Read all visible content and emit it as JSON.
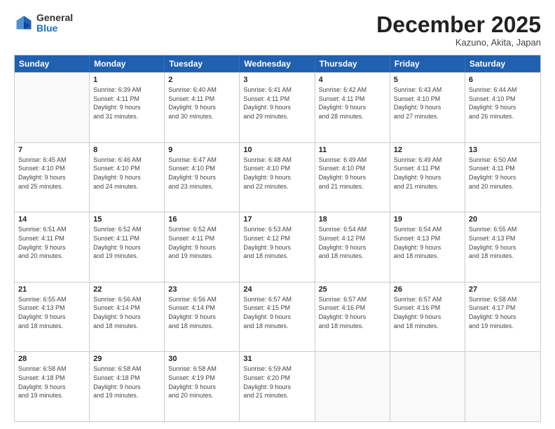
{
  "header": {
    "logo_general": "General",
    "logo_blue": "Blue",
    "month_title": "December 2025",
    "subtitle": "Kazuno, Akita, Japan"
  },
  "weekdays": [
    "Sunday",
    "Monday",
    "Tuesday",
    "Wednesday",
    "Thursday",
    "Friday",
    "Saturday"
  ],
  "rows": [
    [
      {
        "day": "",
        "info": ""
      },
      {
        "day": "1",
        "info": "Sunrise: 6:39 AM\nSunset: 4:11 PM\nDaylight: 9 hours\nand 31 minutes."
      },
      {
        "day": "2",
        "info": "Sunrise: 6:40 AM\nSunset: 4:11 PM\nDaylight: 9 hours\nand 30 minutes."
      },
      {
        "day": "3",
        "info": "Sunrise: 6:41 AM\nSunset: 4:11 PM\nDaylight: 9 hours\nand 29 minutes."
      },
      {
        "day": "4",
        "info": "Sunrise: 6:42 AM\nSunset: 4:11 PM\nDaylight: 9 hours\nand 28 minutes."
      },
      {
        "day": "5",
        "info": "Sunrise: 6:43 AM\nSunset: 4:10 PM\nDaylight: 9 hours\nand 27 minutes."
      },
      {
        "day": "6",
        "info": "Sunrise: 6:44 AM\nSunset: 4:10 PM\nDaylight: 9 hours\nand 26 minutes."
      }
    ],
    [
      {
        "day": "7",
        "info": "Sunrise: 6:45 AM\nSunset: 4:10 PM\nDaylight: 9 hours\nand 25 minutes."
      },
      {
        "day": "8",
        "info": "Sunrise: 6:46 AM\nSunset: 4:10 PM\nDaylight: 9 hours\nand 24 minutes."
      },
      {
        "day": "9",
        "info": "Sunrise: 6:47 AM\nSunset: 4:10 PM\nDaylight: 9 hours\nand 23 minutes."
      },
      {
        "day": "10",
        "info": "Sunrise: 6:48 AM\nSunset: 4:10 PM\nDaylight: 9 hours\nand 22 minutes."
      },
      {
        "day": "11",
        "info": "Sunrise: 6:49 AM\nSunset: 4:10 PM\nDaylight: 9 hours\nand 21 minutes."
      },
      {
        "day": "12",
        "info": "Sunrise: 6:49 AM\nSunset: 4:11 PM\nDaylight: 9 hours\nand 21 minutes."
      },
      {
        "day": "13",
        "info": "Sunrise: 6:50 AM\nSunset: 4:11 PM\nDaylight: 9 hours\nand 20 minutes."
      }
    ],
    [
      {
        "day": "14",
        "info": "Sunrise: 6:51 AM\nSunset: 4:11 PM\nDaylight: 9 hours\nand 20 minutes."
      },
      {
        "day": "15",
        "info": "Sunrise: 6:52 AM\nSunset: 4:11 PM\nDaylight: 9 hours\nand 19 minutes."
      },
      {
        "day": "16",
        "info": "Sunrise: 6:52 AM\nSunset: 4:11 PM\nDaylight: 9 hours\nand 19 minutes."
      },
      {
        "day": "17",
        "info": "Sunrise: 6:53 AM\nSunset: 4:12 PM\nDaylight: 9 hours\nand 18 minutes."
      },
      {
        "day": "18",
        "info": "Sunrise: 6:54 AM\nSunset: 4:12 PM\nDaylight: 9 hours\nand 18 minutes."
      },
      {
        "day": "19",
        "info": "Sunrise: 6:54 AM\nSunset: 4:13 PM\nDaylight: 9 hours\nand 18 minutes."
      },
      {
        "day": "20",
        "info": "Sunrise: 6:55 AM\nSunset: 4:13 PM\nDaylight: 9 hours\nand 18 minutes."
      }
    ],
    [
      {
        "day": "21",
        "info": "Sunrise: 6:55 AM\nSunset: 4:13 PM\nDaylight: 9 hours\nand 18 minutes."
      },
      {
        "day": "22",
        "info": "Sunrise: 6:56 AM\nSunset: 4:14 PM\nDaylight: 9 hours\nand 18 minutes."
      },
      {
        "day": "23",
        "info": "Sunrise: 6:56 AM\nSunset: 4:14 PM\nDaylight: 9 hours\nand 18 minutes."
      },
      {
        "day": "24",
        "info": "Sunrise: 6:57 AM\nSunset: 4:15 PM\nDaylight: 9 hours\nand 18 minutes."
      },
      {
        "day": "25",
        "info": "Sunrise: 6:57 AM\nSunset: 4:16 PM\nDaylight: 9 hours\nand 18 minutes."
      },
      {
        "day": "26",
        "info": "Sunrise: 6:57 AM\nSunset: 4:16 PM\nDaylight: 9 hours\nand 18 minutes."
      },
      {
        "day": "27",
        "info": "Sunrise: 6:58 AM\nSunset: 4:17 PM\nDaylight: 9 hours\nand 19 minutes."
      }
    ],
    [
      {
        "day": "28",
        "info": "Sunrise: 6:58 AM\nSunset: 4:18 PM\nDaylight: 9 hours\nand 19 minutes."
      },
      {
        "day": "29",
        "info": "Sunrise: 6:58 AM\nSunset: 4:18 PM\nDaylight: 9 hours\nand 19 minutes."
      },
      {
        "day": "30",
        "info": "Sunrise: 6:58 AM\nSunset: 4:19 PM\nDaylight: 9 hours\nand 20 minutes."
      },
      {
        "day": "31",
        "info": "Sunrise: 6:59 AM\nSunset: 4:20 PM\nDaylight: 9 hours\nand 21 minutes."
      },
      {
        "day": "",
        "info": ""
      },
      {
        "day": "",
        "info": ""
      },
      {
        "day": "",
        "info": ""
      }
    ]
  ]
}
